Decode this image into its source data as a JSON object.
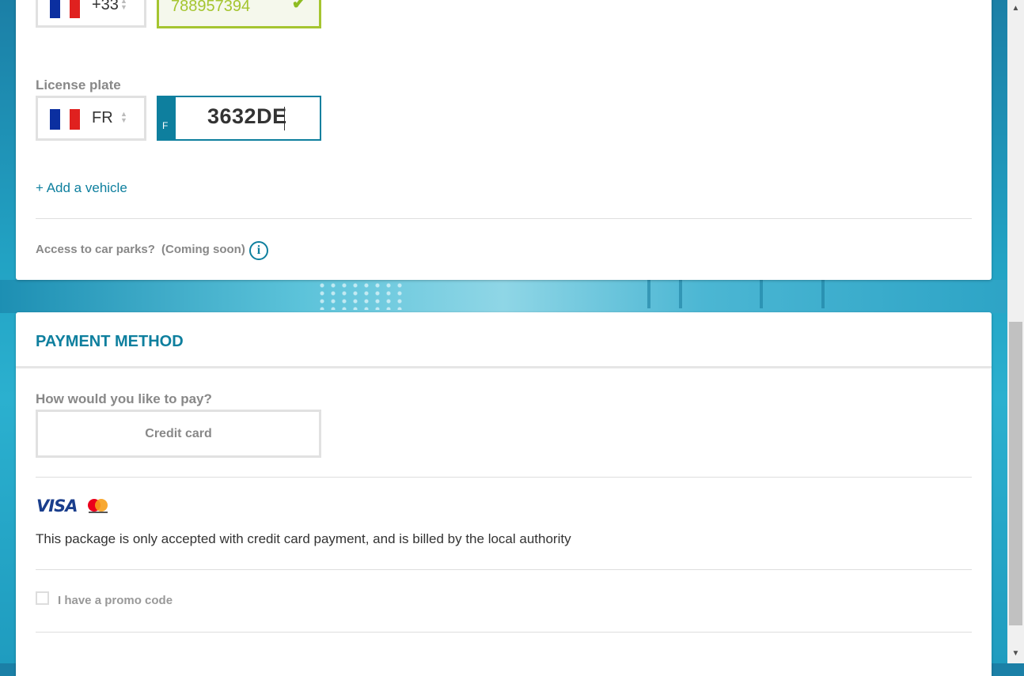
{
  "phone": {
    "country_code": "+33",
    "number_value": "788957394",
    "check_glyph": "✔"
  },
  "license": {
    "label": "License plate",
    "country": "FR",
    "eu_badge_letter": "F",
    "plate_value": "3632DE"
  },
  "vehicle": {
    "add_link": "+ Add a vehicle"
  },
  "car_parks": {
    "text": "Access to car parks?",
    "coming_soon": "(Coming soon)",
    "info_glyph": "i"
  },
  "payment": {
    "title": "PAYMENT METHOD",
    "question": "How would you like to pay?",
    "option": "Credit card",
    "visa_text": "VISA",
    "note": "This package is only accepted with credit card payment, and is billed by the local authority",
    "promo_label": "I have a promo code"
  },
  "icons": {
    "flag": "france-flag-icon",
    "info": "info-icon",
    "check": "check-icon",
    "visa": "visa-logo-icon",
    "mastercard": "mastercard-logo-icon"
  },
  "colors": {
    "accent": "#0e7f9e",
    "valid": "#a5c530",
    "muted": "#888888"
  }
}
